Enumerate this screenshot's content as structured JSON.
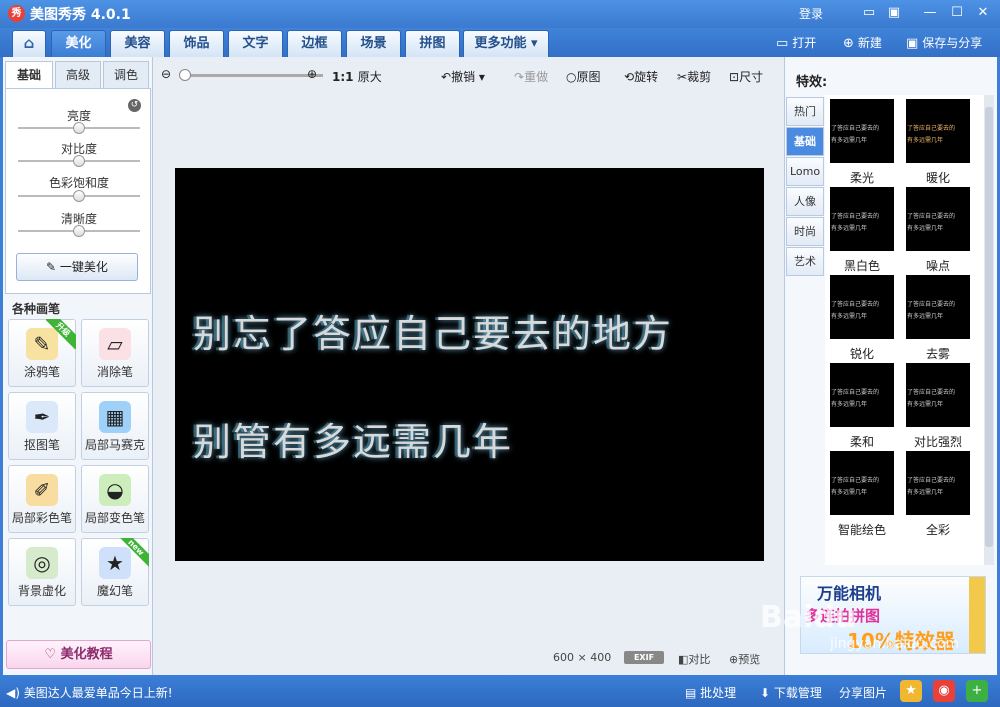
{
  "app": {
    "title": "美图秀秀 4.0.1",
    "logo_text": "秀",
    "login": "登录"
  },
  "window_controls": [
    "message-icon",
    "feedback-icon",
    "minimize-icon",
    "maximize-icon",
    "close-icon"
  ],
  "nav": {
    "tabs": [
      {
        "label": "⌂",
        "icon": "home-icon"
      },
      {
        "label": "美化",
        "active": true
      },
      {
        "label": "美容"
      },
      {
        "label": "饰品"
      },
      {
        "label": "文字"
      },
      {
        "label": "边框"
      },
      {
        "label": "场景"
      },
      {
        "label": "拼图"
      },
      {
        "label": "更多功能 ▾"
      }
    ],
    "actions": {
      "open": "打开",
      "new": "新建",
      "save": "保存与分享"
    }
  },
  "left": {
    "subtabs": [
      "基础",
      "高级",
      "调色"
    ],
    "sliders": [
      {
        "label": "亮度",
        "value": 0.5
      },
      {
        "label": "对比度",
        "value": 0.5
      },
      {
        "label": "色彩饱和度",
        "value": 0.5
      },
      {
        "label": "清晰度",
        "value": 0.5
      }
    ],
    "one_key": "一键美化",
    "brushes_title": "各种画笔",
    "tools": [
      {
        "label": "涂鸦笔",
        "badge": "升级",
        "icon": "paintbrush-icon",
        "color": "#f0c04a"
      },
      {
        "label": "消除笔",
        "icon": "eraser-icon",
        "color": "#f3b6c3"
      },
      {
        "label": "抠图笔",
        "icon": "pen-icon",
        "color": "#8ab4e8"
      },
      {
        "label": "局部马赛克",
        "icon": "mosaic-icon",
        "color": "#6fb6f0"
      },
      {
        "label": "局部彩色笔",
        "icon": "color-brush-icon",
        "color": "#f0b04a"
      },
      {
        "label": "局部变色笔",
        "icon": "paint-bucket-icon",
        "color": "#7fcf5a"
      },
      {
        "label": "背景虚化",
        "icon": "blur-icon",
        "color": "#9bc88a"
      },
      {
        "label": "魔幻笔",
        "badge": "new",
        "icon": "magic-wand-icon",
        "color": "#6aa6ee"
      }
    ],
    "tutorial": "美化教程"
  },
  "canvas": {
    "ratio_label": "1:1",
    "original_size": "原大",
    "undo": "撤销",
    "redo": "重做",
    "original": "原图",
    "rotate": "旋转",
    "crop": "裁剪",
    "resize": "尺寸",
    "photo_lines": [
      "别忘了答应自己要去的地方",
      "别管有多远需几年"
    ],
    "width": "600",
    "times": "×",
    "height": "400",
    "exif": "EXIF",
    "compare": "对比",
    "preview": "预览"
  },
  "right": {
    "title": "特效:",
    "tabs": [
      "热门",
      "基础",
      "Lomo",
      "人像",
      "时尚",
      "艺术"
    ],
    "effects": [
      "柔光",
      "暖化",
      "黑白色",
      "噪点",
      "锐化",
      "去雾",
      "柔和",
      "对比强烈",
      "智能绘色",
      "全彩"
    ],
    "thumb_lines": [
      "了答应自己要去的",
      "有多远需几年"
    ],
    "ad": {
      "title": "万能相机",
      "sub1": "多连拍拼图",
      "sub2": "10%特效器"
    }
  },
  "bottom": {
    "marquee": "美图达人最爱单品今日上新!",
    "batch": "批处理",
    "download": "下载管理",
    "share": "分享图片"
  },
  "watermark": {
    "main": "Baidu",
    "url": "jingyan.baidu.com"
  }
}
